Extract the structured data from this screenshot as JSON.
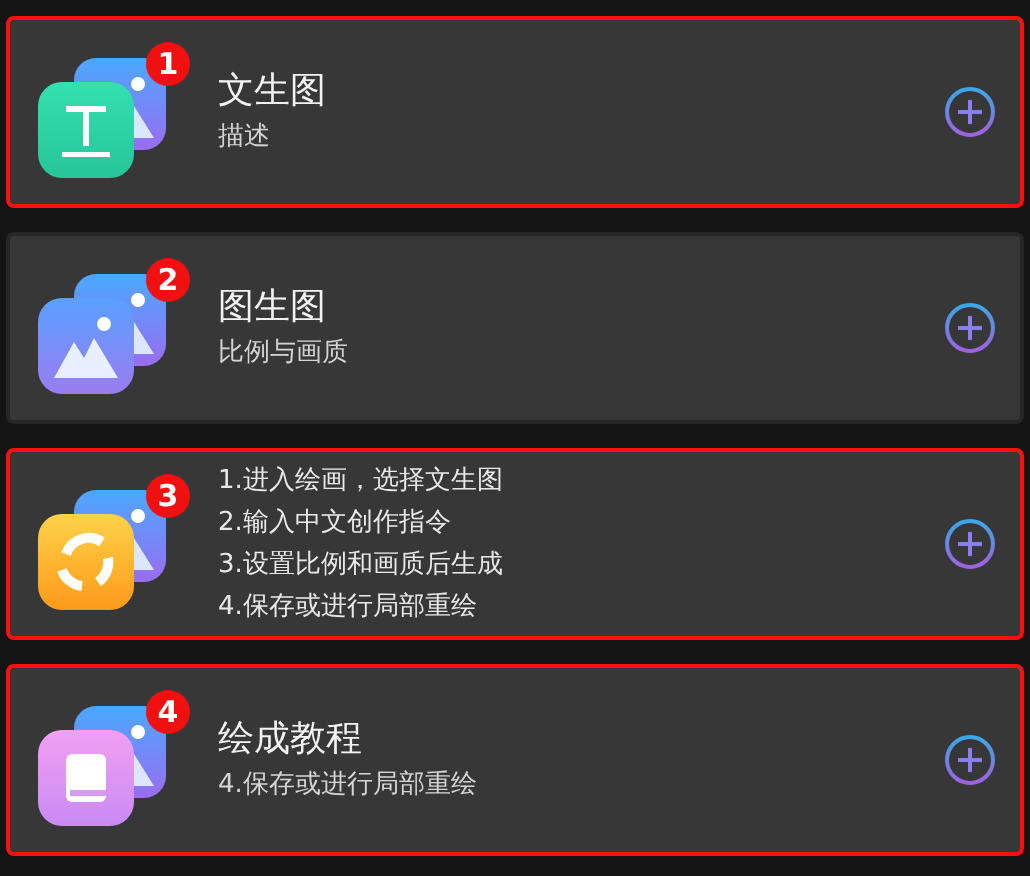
{
  "cards": [
    {
      "badge": "1",
      "kind": "text",
      "highlighted": true,
      "title": "文生图",
      "lines": [
        "描述"
      ]
    },
    {
      "badge": "2",
      "kind": "image",
      "highlighted": false,
      "title": "图生图",
      "lines": [
        "比例与画质"
      ]
    },
    {
      "badge": "3",
      "kind": "refresh",
      "highlighted": true,
      "lines": [
        "1.进入绘画，选择文生图",
        "2.输入中文创作指令",
        "3.设置比例和画质后生成",
        "4.保存或进行局部重绘"
      ]
    },
    {
      "badge": "4",
      "kind": "book",
      "highlighted": true,
      "title": "绘成教程",
      "lines": [
        "4.保存或进行局部重绘"
      ]
    }
  ]
}
